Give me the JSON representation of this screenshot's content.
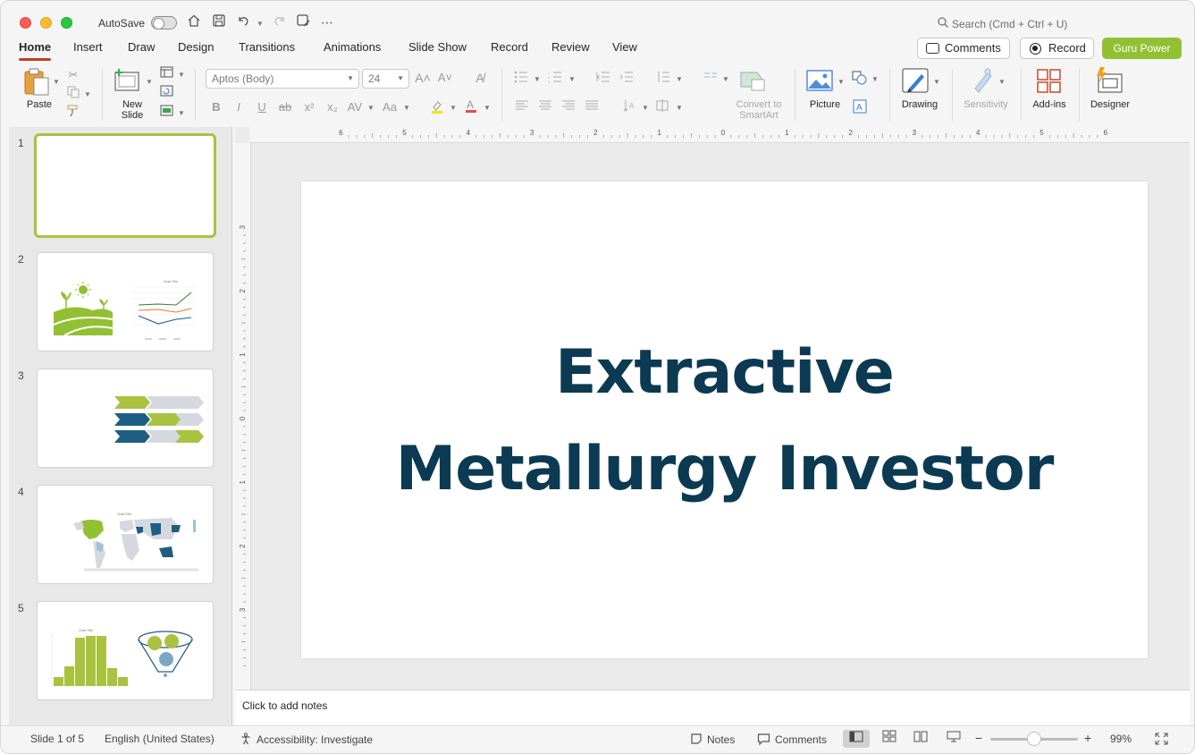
{
  "titlebar": {
    "autosave_label": "AutoSave",
    "search_placeholder": "Search (Cmd + Ctrl + U)"
  },
  "tabs": [
    {
      "label": "Home",
      "active": true
    },
    {
      "label": "Insert"
    },
    {
      "label": "Draw"
    },
    {
      "label": "Design"
    },
    {
      "label": "Transitions"
    },
    {
      "label": "Animations"
    },
    {
      "label": "Slide Show"
    },
    {
      "label": "Record"
    },
    {
      "label": "Review"
    },
    {
      "label": "View"
    }
  ],
  "header_buttons": {
    "comments": "Comments",
    "record": "Record",
    "guru": "Guru Power"
  },
  "ribbon": {
    "paste": "Paste",
    "new_slide": "New\nSlide",
    "font_name": "Aptos (Body)",
    "font_size": "24",
    "convert_smartart": "Convert to\nSmartArt",
    "picture": "Picture",
    "drawing": "Drawing",
    "sensitivity": "Sensitivity",
    "addins": "Add-ins",
    "designer": "Designer"
  },
  "ruler": {
    "h_labels": [
      "6",
      "5",
      "4",
      "3",
      "2",
      "1",
      "0",
      "1",
      "2",
      "3",
      "4",
      "5",
      "6"
    ],
    "v_labels": [
      "3",
      "2",
      "1",
      "0",
      "1",
      "2",
      "3"
    ]
  },
  "slides": [
    {
      "number": "1",
      "selected": true
    },
    {
      "number": "2",
      "chart_title": "Chart Title"
    },
    {
      "number": "3"
    },
    {
      "number": "4",
      "chart_title": "Chart Title"
    },
    {
      "number": "5",
      "chart_title": "Chart Title"
    }
  ],
  "slide_content": {
    "title_line1": "Extractive",
    "title_line2": "Metallurgy Investor"
  },
  "notes_placeholder": "Click to add notes",
  "status": {
    "slide_counter": "Slide 1 of 5",
    "language": "English (United States)",
    "accessibility": "Accessibility: Investigate",
    "notes": "Notes",
    "comments": "Comments",
    "zoom": "99%"
  },
  "colors": {
    "accent_green": "#92c033",
    "dark_blue": "#0b3a52",
    "tab_underline": "#c43e1c",
    "navy": "#1e5e83",
    "grey": "#d5d9df"
  }
}
